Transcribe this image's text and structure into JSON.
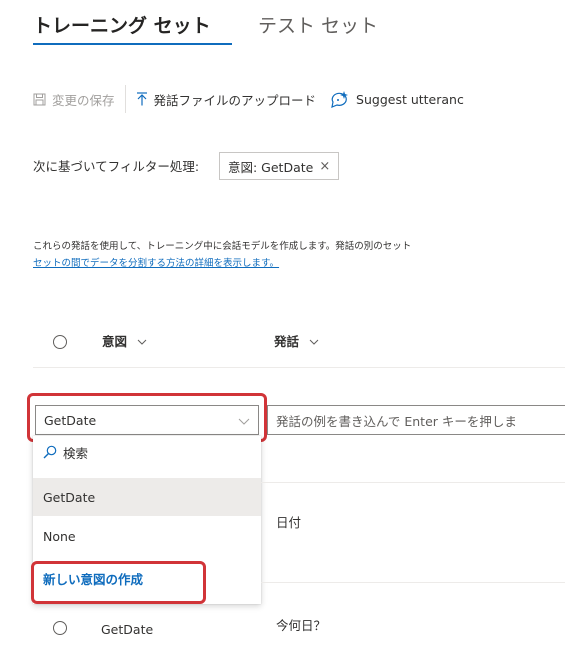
{
  "tabs": {
    "training": "トレーニング セット",
    "test": "テスト セット"
  },
  "toolbar": {
    "save_label": "変更の保存",
    "upload_label": "発話ファイルのアップロード",
    "suggest_label": "Suggest utteranc"
  },
  "filter": {
    "label": "次に基づいてフィルター処理:",
    "chip_label": "意図: GetDate",
    "chip_close": "×"
  },
  "description": {
    "text": "これらの発話を使用して、トレーニング中に会話モデルを作成します。発話の別のセット",
    "link": "セットの間でデータを分割する方法の詳細を表示します。"
  },
  "table": {
    "columns": [
      "意図",
      "発話"
    ]
  },
  "editor": {
    "intent_value": "GetDate",
    "utterance_placeholder": "発話の例を書き込んで Enter キーを押しま"
  },
  "dropdown": {
    "search_placeholder": "検索",
    "options": [
      "GetDate",
      "None"
    ],
    "selected": "GetDate",
    "create_new": "新しい意図の作成"
  },
  "rows": [
    {
      "intent": "GetDate",
      "utterance": "日付"
    },
    {
      "intent": "GetDate",
      "utterance": "今何日？"
    }
  ],
  "colors": {
    "accent": "#0f6cbd",
    "highlight": "#d13438",
    "selected_bg": "#edebe9"
  },
  "icons": {
    "save": "save-icon",
    "upload": "upload-icon",
    "suggest": "sparkle-chat-icon",
    "search": "search-icon",
    "chevron": "chevron-down-icon",
    "close": "close-icon"
  }
}
